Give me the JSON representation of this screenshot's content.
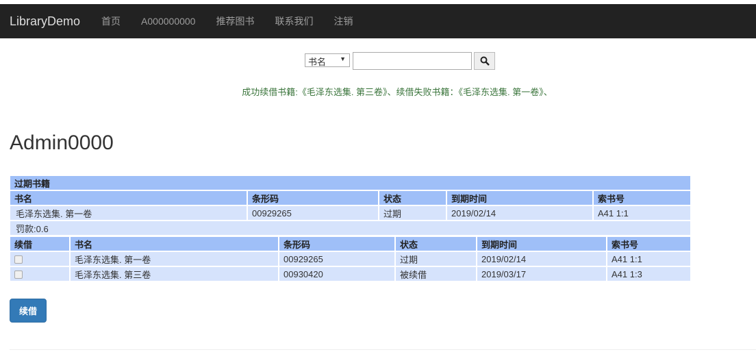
{
  "nav": {
    "brand": "LibraryDemo",
    "items": [
      "首页",
      "A000000000",
      "推荐图书",
      "联系我们",
      "注销"
    ]
  },
  "search": {
    "select_value": "书名",
    "input_value": "",
    "placeholder": ""
  },
  "message": "成功续借书籍:《毛泽东选集. 第三卷》、续借失败书籍：《毛泽东选集. 第一卷》、",
  "title": "Admin0000",
  "overdue": {
    "caption": "过期书籍",
    "headers": [
      "书名",
      "条形码",
      "状态",
      "到期时间",
      "索书号"
    ],
    "rows": [
      [
        "毛泽东选集. 第一卷",
        "00929265",
        "过期",
        "2019/02/14",
        "A41 1:1"
      ]
    ],
    "fine": "罚款:0.6"
  },
  "renew": {
    "headers": [
      "续借",
      "书名",
      "条形码",
      "状态",
      "到期时间",
      "索书号"
    ],
    "rows": [
      [
        "毛泽东选集. 第一卷",
        "00929265",
        "过期",
        "2019/02/14",
        "A41 1:1"
      ],
      [
        "毛泽东选集. 第三卷",
        "00930420",
        "被续借",
        "2019/03/17",
        "A41 1:3"
      ]
    ]
  },
  "button": "续借"
}
